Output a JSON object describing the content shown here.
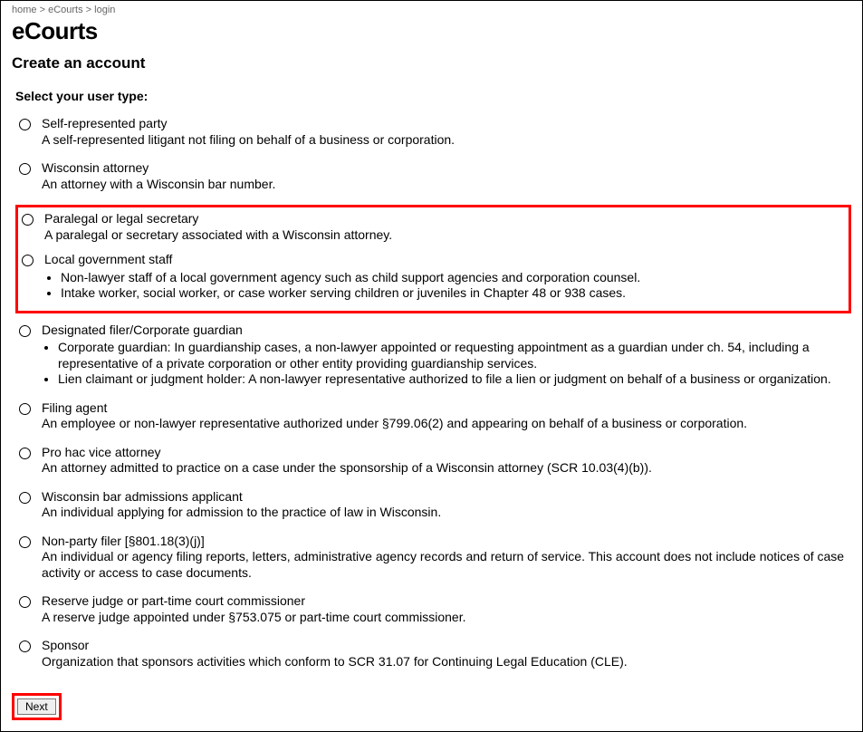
{
  "breadcrumb": {
    "items": [
      "home",
      "eCourts",
      "login"
    ],
    "sep": " > "
  },
  "page_title": "eCourts",
  "sub_title": "Create an account",
  "section_label": "Select your user type:",
  "options": {
    "self_rep": {
      "title": "Self-represented party",
      "desc": "A self-represented litigant not filing on behalf of a business or corporation."
    },
    "wi_attorney": {
      "title": "Wisconsin attorney",
      "desc": "An attorney with a Wisconsin bar number."
    },
    "paralegal": {
      "title": "Paralegal or legal secretary",
      "desc": "A paralegal or secretary associated with a Wisconsin attorney."
    },
    "local_gov": {
      "title": "Local government staff",
      "bullets": [
        "Non-lawyer staff of a local government agency such as child support agencies and corporation counsel.",
        "Intake worker, social worker, or case worker serving children or juveniles in Chapter 48 or 938 cases."
      ]
    },
    "designated": {
      "title": "Designated filer/Corporate guardian",
      "bullets": [
        "Corporate guardian: In guardianship cases, a non-lawyer appointed or requesting appointment as a guardian under ch. 54, including a representative of a private corporation or other entity providing guardianship services.",
        "Lien claimant or judgment holder: A non-lawyer representative authorized to file a lien or judgment on behalf of a business or organization."
      ]
    },
    "filing_agent": {
      "title": "Filing agent",
      "desc": "An employee or non-lawyer representative authorized under §799.06(2) and appearing on behalf of a business or corporation."
    },
    "pro_hac": {
      "title": "Pro hac vice attorney",
      "desc": "An attorney admitted to practice on a case under the sponsorship of a Wisconsin attorney (SCR 10.03(4)(b))."
    },
    "bar_admission": {
      "title": "Wisconsin bar admissions applicant",
      "desc": "An individual applying for admission to the practice of law in Wisconsin."
    },
    "non_party": {
      "title": "Non-party filer [§801.18(3)(j)]",
      "desc": "An individual or agency filing reports, letters, administrative agency records and return of service. This account does not include notices of case activity or access to case documents."
    },
    "reserve_judge": {
      "title": "Reserve judge or part-time court commissioner",
      "desc": "A reserve judge appointed under §753.075 or part-time court commissioner."
    },
    "sponsor": {
      "title": "Sponsor",
      "desc": "Organization that sponsors activities which conform to SCR 31.07 for Continuing Legal Education (CLE)."
    }
  },
  "next_label": "Next"
}
